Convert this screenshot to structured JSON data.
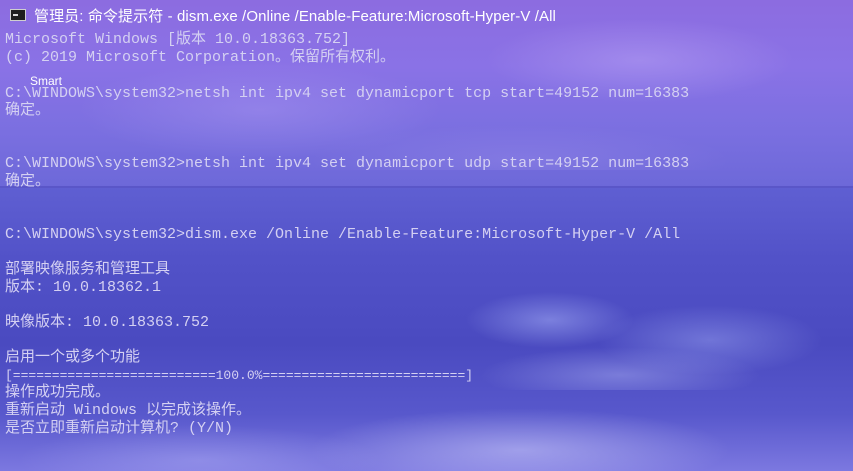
{
  "window": {
    "title": "管理员: 命令提示符 - dism.exe  /Online /Enable-Feature:Microsoft-Hyper-V /All",
    "icon": "cmd-icon"
  },
  "desktop": {
    "label": "Smart"
  },
  "console": {
    "lines": [
      "Microsoft Windows [版本 10.0.18363.752]",
      "(c) 2019 Microsoft Corporation。保留所有权利。",
      "C:\\WINDOWS\\system32>netsh int ipv4 set dynamicport tcp start=49152 num=16383",
      "确定。",
      "C:\\WINDOWS\\system32>netsh int ipv4 set dynamicport udp start=49152 num=16383",
      "确定。",
      "C:\\WINDOWS\\system32>dism.exe /Online /Enable-Feature:Microsoft-Hyper-V /All",
      "部署映像服务和管理工具",
      "版本: 10.0.18362.1",
      "映像版本: 10.0.18363.752",
      "启用一个或多个功能",
      "[==========================100.0%==========================]",
      "操作成功完成。",
      "重新启动 Windows 以完成该操作。",
      "是否立即重新启动计算机? (Y/N)"
    ]
  },
  "colors": {
    "text": "#d4d0f2",
    "title_text": "#ffffff",
    "sky": "#8a72e6",
    "sea": "#4a4ac0"
  }
}
